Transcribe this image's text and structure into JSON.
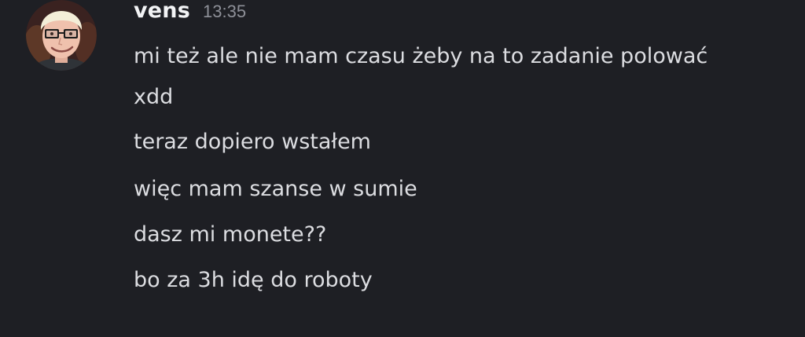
{
  "message": {
    "author": "vens",
    "timestamp": "13:35",
    "avatar_icon": "user-avatar-icon",
    "lines": [
      "mi też ale nie mam czasu żeby na to zadanie polować",
      "xdd",
      "teraz dopiero wstałem",
      "więc mam szanse w sumie",
      "dasz mi monete??",
      "bo za 3h idę do roboty"
    ]
  },
  "colors": {
    "background": "#1e1f24",
    "username": "#f2f3f5",
    "timestamp": "#8e9098",
    "message_text": "#dcdde1"
  }
}
